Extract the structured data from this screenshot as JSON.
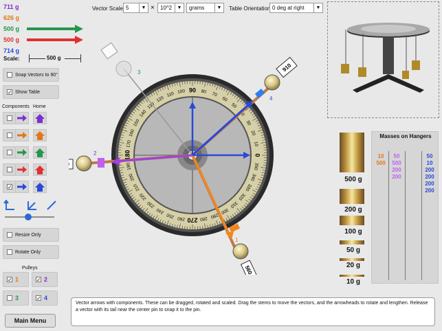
{
  "vectors": [
    {
      "label": "711 g",
      "color": "#7b2fd0",
      "arrow": false
    },
    {
      "label": "626 g",
      "color": "#e07818",
      "arrow": false
    },
    {
      "label": "500 g",
      "color": "#23984a",
      "arrow": true
    },
    {
      "label": "500 g",
      "color": "#e03030",
      "arrow": true
    },
    {
      "label": "714 g",
      "color": "#2a49d8",
      "arrow": false
    }
  ],
  "scale": {
    "label": "Scale:",
    "value": "500 g"
  },
  "controls": {
    "snap_label": "Snap Vectors to 90°",
    "show_table_label": "Show Table",
    "components_label": "Components",
    "home_label": "Home",
    "resize_only": "Resize Only",
    "rotate_only": "Rotate Only",
    "pulleys_label": "Pulleys",
    "pulleys": [
      "1",
      "2",
      "3",
      "4"
    ],
    "main_menu": "Main Menu"
  },
  "toolbar": {
    "vector_scale_label": "Vector Scale:",
    "scale_value": "5",
    "times": "×",
    "exponent": "10^2",
    "units": "grams",
    "orientation_label": "Table Orientation:",
    "orientation_value": "0 deg at right"
  },
  "dial": {
    "major": [
      "90",
      "0",
      "270",
      "180"
    ],
    "minor": [
      "10",
      "20",
      "30",
      "40",
      "50",
      "60",
      "70",
      "80",
      "100",
      "110",
      "120",
      "130",
      "140",
      "150",
      "160",
      "170",
      "190",
      "200",
      "210",
      "220",
      "230",
      "240",
      "250",
      "260",
      "280",
      "290",
      "300",
      "310",
      "320",
      "330",
      "340",
      "350"
    ]
  },
  "pulley_tags": [
    {
      "num": "1",
      "weight": "560"
    },
    {
      "num": "2",
      "weight": "1000"
    },
    {
      "num": "3",
      "weight": ""
    },
    {
      "num": "4",
      "weight": "910"
    }
  ],
  "mass_blocks": [
    "500 g",
    "200 g",
    "100 g",
    "50 g",
    "20 g",
    "10 g"
  ],
  "hangers": {
    "title": "Masses on Hangers",
    "col1": [
      "10",
      "500"
    ],
    "col2": [
      "50",
      "500",
      "200",
      "200"
    ],
    "col3": [],
    "col4": [
      "50",
      "10",
      "200",
      "200",
      "200",
      "200"
    ]
  },
  "instructions": "Vector arrows with components. These can be dragged, rotated and scaled. Drag the stems to move the vectors, and the arrowheads to rotate and lengthen. Release a vector with its tail near the center pin to snap it to the  pin."
}
